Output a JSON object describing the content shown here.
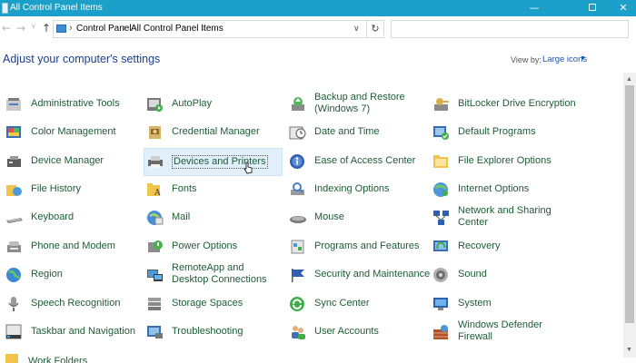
{
  "window": {
    "title": "All Control Panel Items",
    "min_glyph": "—",
    "close_glyph": "✕"
  },
  "address": {
    "segments": [
      "Control Panel",
      "All Control Panel Items"
    ],
    "separator": "›",
    "dropdown_glyph": "∨",
    "refresh_glyph": "↻",
    "back_glyph": "←",
    "forward_glyph": "→",
    "recent_glyph": "∨",
    "up_glyph": "↑"
  },
  "search": {
    "placeholder": ""
  },
  "heading": "Adjust your computer's settings",
  "view_by": {
    "label": "View by:",
    "value": "Large icons",
    "dropdown_glyph": "▼"
  },
  "scroll": {
    "up_glyph": "▲",
    "down_glyph": "▼"
  },
  "columns": [
    [
      {
        "label": "Administrative Tools",
        "icon": "admin-tools-icon"
      },
      {
        "label": "Color Management",
        "icon": "color-management-icon"
      },
      {
        "label": "Device Manager",
        "icon": "device-manager-icon"
      },
      {
        "label": "File History",
        "icon": "file-history-icon"
      },
      {
        "label": "Keyboard",
        "icon": "keyboard-icon"
      },
      {
        "label": "Phone and Modem",
        "icon": "phone-modem-icon"
      },
      {
        "label": "Region",
        "icon": "region-icon"
      },
      {
        "label": "Speech Recognition",
        "icon": "microphone-icon"
      },
      {
        "label": "Taskbar and Navigation",
        "icon": "taskbar-icon"
      }
    ],
    [
      {
        "label": "AutoPlay",
        "icon": "autoplay-icon"
      },
      {
        "label": "Credential Manager",
        "icon": "credential-icon"
      },
      {
        "label": "Devices and Printers",
        "icon": "printer-icon"
      },
      {
        "label": "Fonts",
        "icon": "fonts-icon"
      },
      {
        "label": "Mail",
        "icon": "mail-icon"
      },
      {
        "label": "Power Options",
        "icon": "power-icon"
      },
      {
        "label": "RemoteApp and Desktop Connections",
        "icon": "remoteapp-icon"
      },
      {
        "label": "Storage Spaces",
        "icon": "storage-icon"
      },
      {
        "label": "Troubleshooting",
        "icon": "troubleshoot-icon"
      }
    ],
    [
      {
        "label": "Backup and Restore (Windows 7)",
        "icon": "backup-icon"
      },
      {
        "label": "Date and Time",
        "icon": "clock-icon"
      },
      {
        "label": "Ease of Access Center",
        "icon": "ease-of-access-icon"
      },
      {
        "label": "Indexing Options",
        "icon": "indexing-icon"
      },
      {
        "label": "Mouse",
        "icon": "mouse-icon"
      },
      {
        "label": "Programs and Features",
        "icon": "programs-icon"
      },
      {
        "label": "Security and Maintenance",
        "icon": "flag-icon"
      },
      {
        "label": "Sync Center",
        "icon": "sync-icon"
      },
      {
        "label": "User Accounts",
        "icon": "users-icon"
      }
    ],
    [
      {
        "label": "BitLocker Drive Encryption",
        "icon": "bitlocker-icon"
      },
      {
        "label": "Default Programs",
        "icon": "default-programs-icon"
      },
      {
        "label": "File Explorer Options",
        "icon": "folder-options-icon"
      },
      {
        "label": "Internet Options",
        "icon": "internet-icon"
      },
      {
        "label": "Network and Sharing Center",
        "icon": "network-icon"
      },
      {
        "label": "Recovery",
        "icon": "recovery-icon"
      },
      {
        "label": "Sound",
        "icon": "speaker-icon"
      },
      {
        "label": "System",
        "icon": "system-icon"
      },
      {
        "label": "Windows Defender Firewall",
        "icon": "firewall-icon"
      }
    ]
  ],
  "partial_item": {
    "label": "Work Folders",
    "icon": "work-folders-icon"
  }
}
